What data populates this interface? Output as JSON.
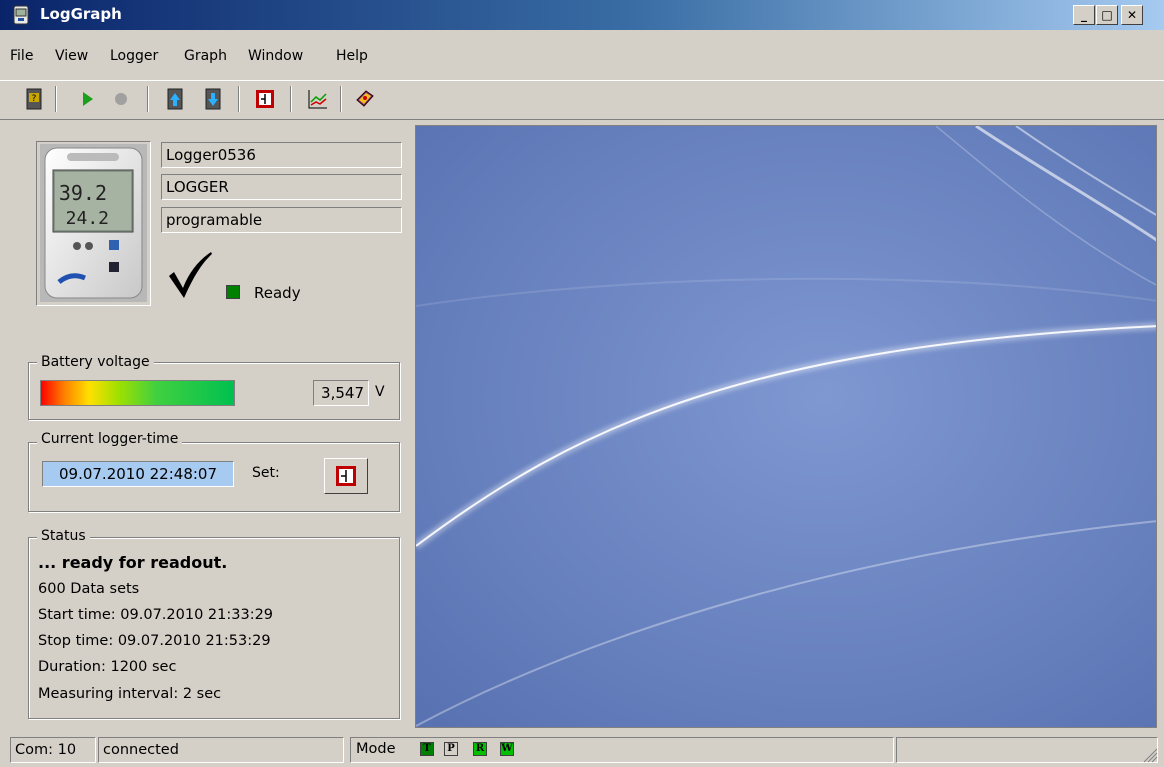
{
  "window": {
    "title": "LogGraph",
    "controls": {
      "minimize": "_",
      "maximize": "□",
      "close": "✕"
    }
  },
  "menu": {
    "items": [
      "File",
      "View",
      "Logger",
      "Graph",
      "Window",
      "Help"
    ]
  },
  "toolbar": {
    "buttons": [
      "logger-info-icon",
      "play-icon",
      "stop-icon",
      "upload-icon",
      "download-icon",
      "set-time-icon",
      "graph-icon",
      "help-book-icon"
    ]
  },
  "logger": {
    "name": "Logger0536",
    "type": "LOGGER",
    "mode": "programable",
    "device_display": {
      "top": "39.2",
      "bottom": "24.2"
    },
    "state": "Ready",
    "state_color": "#008000"
  },
  "battery": {
    "title": "Battery voltage",
    "value": "3,547",
    "unit": "V"
  },
  "logger_time": {
    "title": "Current logger-time",
    "value": "09.07.2010 22:48:07",
    "set_label": "Set:"
  },
  "status": {
    "title": "Status",
    "headline": "... ready for readout.",
    "lines": [
      "600 Data sets",
      "Start time: 09.07.2010 21:33:29",
      "Stop time: 09.07.2010 21:53:29",
      "Duration: 1200 sec",
      "Measuring interval: 2 sec"
    ]
  },
  "statusbar": {
    "com": "Com: 10",
    "connection": "connected",
    "mode_label": "Mode",
    "mode_indicators": [
      {
        "letter": "T",
        "color": "#008000"
      },
      {
        "letter": "P",
        "color": "#d4d0c8"
      },
      {
        "letter": "R",
        "color": "#00c000"
      },
      {
        "letter": "W",
        "color": "#00c000"
      }
    ]
  }
}
